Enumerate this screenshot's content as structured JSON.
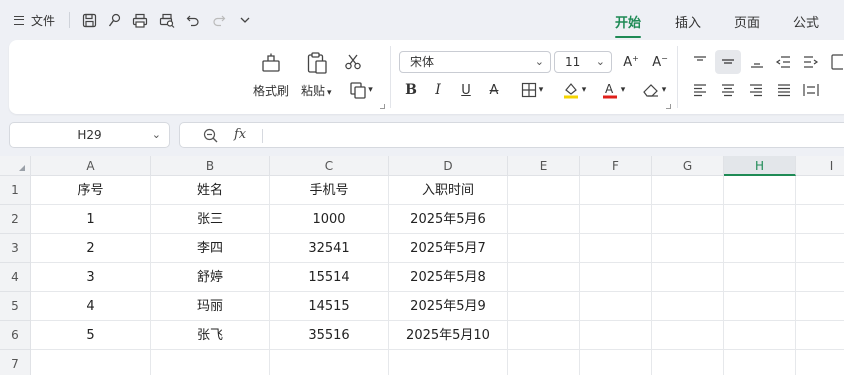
{
  "topbar": {
    "file_label": "文件",
    "quick_access_icons": [
      "save-icon",
      "format-painter-quick-icon",
      "print-icon",
      "print-preview-icon",
      "undo-icon",
      "redo-icon",
      "more-chevron-icon"
    ],
    "tabs": [
      {
        "label": "开始",
        "active": true
      },
      {
        "label": "插入",
        "active": false
      },
      {
        "label": "页面",
        "active": false
      },
      {
        "label": "公式",
        "active": false
      }
    ],
    "accent": "#1e8a55"
  },
  "ribbon": {
    "format_painter_label": "格式刷",
    "paste_label": "粘贴",
    "font_name": "宋体",
    "font_size": "11",
    "highlight_color": "#f5d400",
    "font_color": "#e0201b"
  },
  "formula_bar": {
    "cell_ref": "H29",
    "fx_label": "fx",
    "formula": ""
  },
  "sheet": {
    "columns": [
      "A",
      "B",
      "C",
      "D",
      "E",
      "F",
      "G",
      "H",
      "I"
    ],
    "selected_column": "H",
    "rows": [
      "1",
      "2",
      "3",
      "4",
      "5",
      "6",
      "7"
    ],
    "cells": [
      [
        "序号",
        "姓名",
        "手机号",
        "入职时间"
      ],
      [
        "1",
        "张三",
        "1000",
        "2025年5月6"
      ],
      [
        "2",
        "李四",
        "32541",
        "2025年5月7"
      ],
      [
        "3",
        "舒婷",
        "15514",
        "2025年5月8"
      ],
      [
        "4",
        "玛丽",
        "14515",
        "2025年5月9"
      ],
      [
        "5",
        "张飞",
        "35516",
        "2025年5月10"
      ],
      [
        "",
        "",
        "",
        ""
      ]
    ]
  }
}
